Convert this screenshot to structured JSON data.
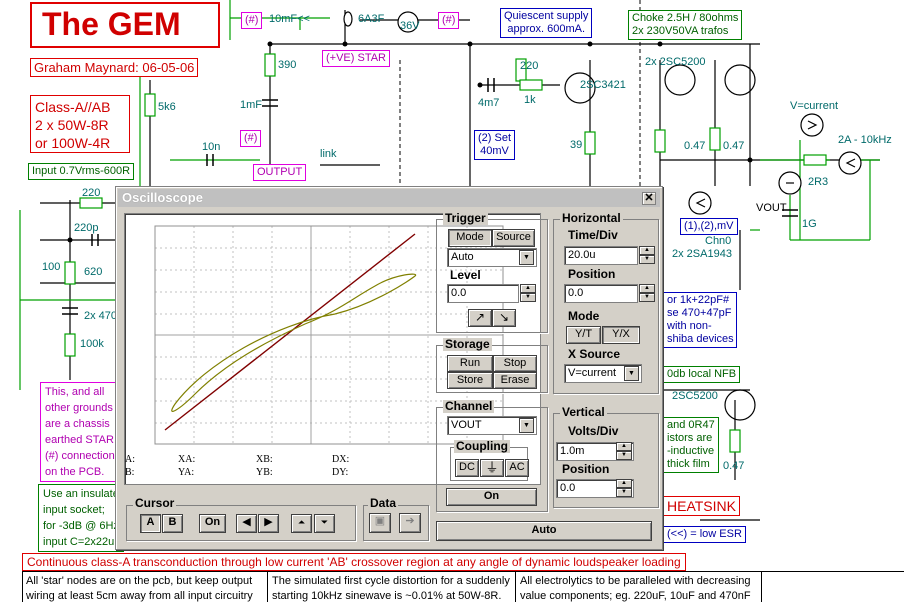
{
  "schematic": {
    "title": "The GEM",
    "author": "Graham Maynard: 06-05-06",
    "class_lines": [
      "Class-A//AB",
      "2 x 50W-8R",
      "or 100W-4R"
    ],
    "input_spec": "Input 0.7Vrms-600R",
    "fuse_label": "6A3F",
    "supply_label": "36V",
    "cap_10mf": "10mF<<",
    "star_marker": "(#)",
    "star_label": "(+VE) STAR",
    "quiescent_box": [
      "Quiescent supply",
      "approx. 600mA."
    ],
    "choke_box": [
      "Choke 2.5H / 80ohms",
      "2x 230V50VA trafos"
    ],
    "r390": "390",
    "r220_top": "220",
    "c4m7": "4m7",
    "r1k": "1k",
    "q_2sc3421": "2SC3421",
    "q_2sc5200_pair": "2x 2SC5200",
    "r5k6": "5k6",
    "c1mf": "1mF",
    "c10n": "10n",
    "output_label": "OUTPUT",
    "link_label": "link",
    "set_box": [
      "(2) Set",
      "40mV"
    ],
    "r39": "39",
    "r047_a": "0.47",
    "r047_b": "0.47",
    "r047_c": "0.47",
    "vcurrent": "V=current",
    "freq_label": "2A - 10kHz",
    "r2r3": "2R3",
    "vout_label": "VOUT",
    "c1g": "1G",
    "chn_box": "(1),(2),mV",
    "chn0": "Chn0",
    "q_2sa1943": "2x 2SA1943",
    "r220_left": "220",
    "c220p": "220p",
    "r100": "100",
    "r620": "620",
    "c2x470": "2x 470",
    "r100k": "100k",
    "comp_box": [
      "or 1k+22pF#",
      "se 470+47pF",
      "with non-",
      "shiba devices"
    ],
    "nfb_box": "0db local NFB",
    "q_2sc5200": "2SC5200",
    "resist_note": [
      "and 0R47",
      "istors are",
      "-inductive",
      "thick film"
    ],
    "heatsink": "HEATSINK",
    "esr_note": "(<<) = low ESR",
    "ground_note": [
      "This, and all",
      "other grounds",
      "are a chassis",
      "earthed STAR",
      "(#) connection",
      "on the PCB."
    ],
    "insulate_note": [
      "Use an insulate",
      "input socket;",
      "for -3dB @ 6Hz",
      "input C=2x22u"
    ],
    "bottom_banner": "Continuous class-A transconduction through low current 'AB' crossover region at any angle of dynamic loudspeaker loading",
    "footer_cols": [
      [
        "All 'star' nodes are on the pcb,  but keep output",
        "wiring at least 5cm away from all input circuitry"
      ],
      [
        "The simulated first cycle distortion for a suddenly",
        "starting 10kHz sinewave is  ~0.01% at 50W-8R."
      ],
      [
        "All electrolytics to be paralleled with decreasing",
        "value components;  eg. 220uF, 10uF and 470nF"
      ]
    ],
    "colors": {
      "title_red": "#e00000",
      "wire_green": "#00a000",
      "wire_dark": "#000000",
      "label_blue": "#0000a0"
    }
  },
  "oscilloscope": {
    "title": "Oscilloscope",
    "close_icon": "close-icon",
    "readouts": {
      "a": "A:",
      "b": "B:",
      "xa": "XA:",
      "ya": "YA:",
      "xb": "XB:",
      "yb": "YB:",
      "dx": "DX:",
      "dy": "DY:"
    },
    "trigger": {
      "title": "Trigger",
      "mode_btn": "Mode",
      "source_btn": "Source",
      "mode_value": "Auto",
      "level_label": "Level",
      "level_value": "0.0",
      "rising_icon": "rising-edge-icon",
      "falling_icon": "falling-edge-icon"
    },
    "horizontal": {
      "title": "Horizontal",
      "time_label": "Time/Div",
      "time_value": "20.0u",
      "position_label": "Position",
      "position_value": "0.0",
      "mode_label": "Mode",
      "yt_btn": "Y/T",
      "yx_btn": "Y/X",
      "xsource_label": "X Source",
      "xsource_value": "V=current"
    },
    "storage": {
      "title": "Storage",
      "run": "Run",
      "stop": "Stop",
      "store": "Store",
      "erase": "Erase"
    },
    "channel": {
      "title": "Channel",
      "value": "VOUT",
      "coupling_title": "Coupling",
      "dc": "DC",
      "gnd_icon": "ground-icon",
      "ac": "AC",
      "on": "On"
    },
    "vertical": {
      "title": "Vertical",
      "volts_label": "Volts/Div",
      "volts_value": "1.0m",
      "position_label": "Position",
      "position_value": "0.0"
    },
    "cursor": {
      "title": "Cursor",
      "a": "A",
      "b": "B",
      "on": "On",
      "left_icon": "arrow-left-icon",
      "right_icon": "arrow-right-icon",
      "up_icon": "arrow-up-double-icon",
      "down_icon": "arrow-down-double-icon"
    },
    "data_group": {
      "title": "Data",
      "open_icon": "open-data-icon",
      "export_icon": "export-data-icon"
    },
    "auto_btn": "Auto",
    "trace_colors": {
      "line": "#800000",
      "loop": "#808000"
    }
  }
}
